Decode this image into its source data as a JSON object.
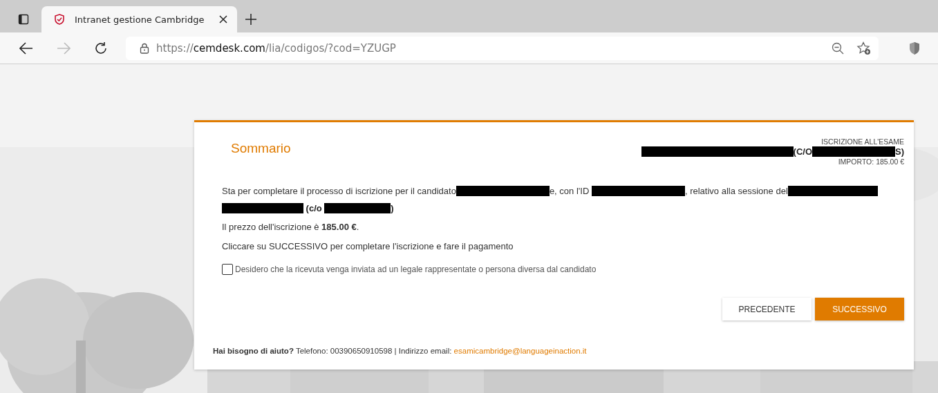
{
  "browser": {
    "tab": {
      "title": "Intranet gestione Cambridge",
      "selected": true
    },
    "url": {
      "host_prefix": "https://",
      "host": "cemdesk.com",
      "path": "/lia/codigos/?cod=YZUGP"
    }
  },
  "card": {
    "title": "Sommario",
    "header_info": {
      "label": "ISCRIZIONE ALL'ESAME",
      "detail": [
        {
          "kind": "redacted"
        },
        {
          "kind": "text",
          "text": " (C/O"
        },
        {
          "kind": "redacted"
        },
        {
          "kind": "text",
          "text": "S)"
        }
      ],
      "amount": "IMPORTO: 185.00 €"
    },
    "summary": [
      {
        "kind": "text",
        "text": "Sta per completare il processo di iscrizione per il candidato"
      },
      {
        "kind": "redacted"
      },
      {
        "kind": "text",
        "text": "e, con l'ID "
      },
      {
        "kind": "redacted"
      },
      {
        "kind": "text",
        "text": ", relativo alla sessione del"
      },
      {
        "kind": "redacted"
      },
      {
        "kind": "break"
      },
      {
        "kind": "redacted"
      },
      {
        "kind": "bold",
        "text": " (c/o "
      },
      {
        "kind": "redacted"
      },
      {
        "kind": "bold",
        "text": ")"
      }
    ],
    "price": "Il prezzo dell'iscrizione è **185.00 €**.",
    "instruction": "Cliccare su SUCCESSIVO per completare l'iscrizione e fare il pagamento",
    "checkbox": {
      "label": "Desidero che la ricevuta venga inviata ad un legale rappresentate o persona diversa dal candidato",
      "checked": false
    },
    "buttons": [
      {
        "label": "PRECEDENTE",
        "kind": "secondary"
      },
      {
        "label": "SUCCESSIVO",
        "kind": "primary"
      }
    ],
    "help": {
      "question": "Hai bisogno di aiuto?",
      "text": " Telefono: 00390650910598 | Indirizzo email: ",
      "email": "esamicambridge@languageinaction.it"
    }
  }
}
